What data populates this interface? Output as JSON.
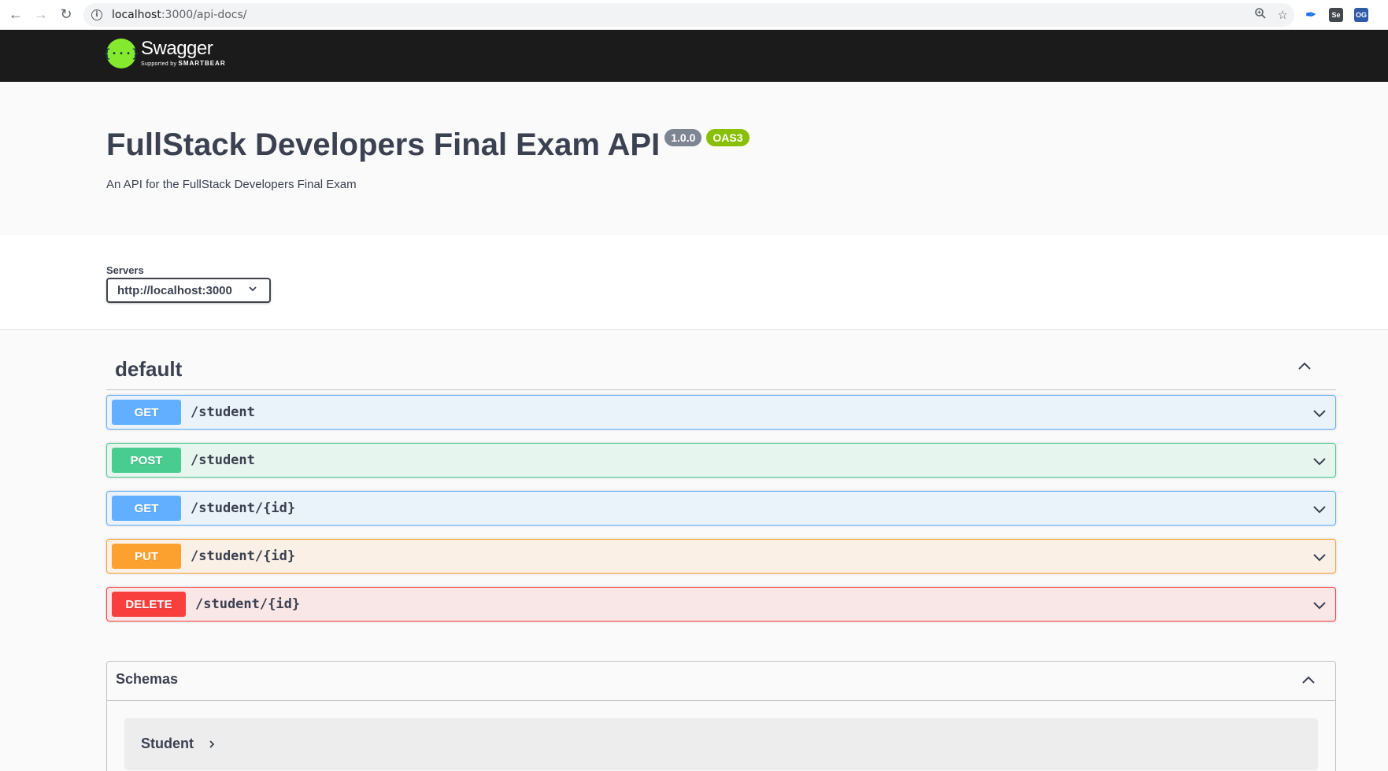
{
  "browser": {
    "url_host": "localhost",
    "url_path": ":3000/api-docs/",
    "extensions": [
      {
        "name": "feather-extension-icon",
        "label": "",
        "color": "#1a73e8"
      },
      {
        "name": "selenium-extension-icon",
        "label": "Se",
        "color": "#43484f"
      },
      {
        "name": "og-extension-icon",
        "label": "OG",
        "color": "#2f5aa8"
      }
    ]
  },
  "topbar": {
    "brand": "Swagger",
    "supported_by": "Supported by",
    "smartbear": "SMARTBEAR",
    "logo_glyph": "{···}"
  },
  "info": {
    "title": "FullStack Developers Final Exam API",
    "version": "1.0.0",
    "oas": "OAS3",
    "description": "An API for the FullStack Developers Final Exam"
  },
  "servers": {
    "label": "Servers",
    "selected": "http://localhost:3000"
  },
  "tag": {
    "name": "default"
  },
  "operations": [
    {
      "method": "GET",
      "path": "/student",
      "color": "#61affe"
    },
    {
      "method": "POST",
      "path": "/student",
      "color": "#49cc90"
    },
    {
      "method": "GET",
      "path": "/student/{id}",
      "color": "#61affe"
    },
    {
      "method": "PUT",
      "path": "/student/{id}",
      "color": "#fca130"
    },
    {
      "method": "DELETE",
      "path": "/student/{id}",
      "color": "#f93e3e"
    }
  ],
  "schemas": {
    "title": "Schemas",
    "models": [
      "Student"
    ]
  }
}
